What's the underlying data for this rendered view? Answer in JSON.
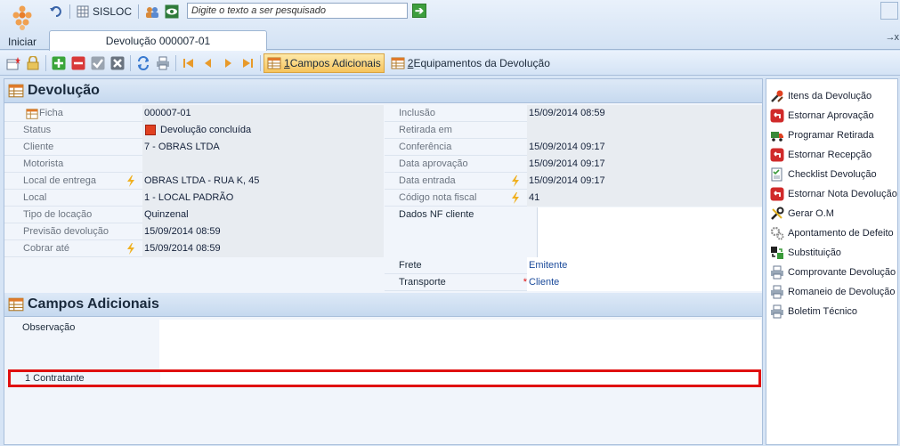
{
  "top": {
    "start_label": "Iniciar",
    "app_name": "SISLOC",
    "search_placeholder": "Digite o texto a ser pesquisado",
    "doc_tab": "Devolução 000007-01",
    "tab_arrows": "→x"
  },
  "toolbar": {
    "tab1_num": "1",
    "tab1_label": " Campos Adicionais",
    "tab2_num": "2",
    "tab2_label": " Equipamentos da Devolução"
  },
  "devolucao": {
    "title": "Devolução",
    "left_rows": [
      {
        "label": "Ficha",
        "value": "000007-01"
      },
      {
        "label": "Status",
        "value": "Devolução concluída"
      },
      {
        "label": "Cliente",
        "value": "7 - OBRAS LTDA"
      },
      {
        "label": "Motorista",
        "value": ""
      },
      {
        "label": "Local de entrega",
        "value": "OBRAS LTDA - RUA K, 45"
      },
      {
        "label": "Local",
        "value": "1 - LOCAL PADRÃO"
      },
      {
        "label": "Tipo de locação",
        "value": "Quinzenal"
      },
      {
        "label": "Previsão devolução",
        "value": "15/09/2014 08:59"
      },
      {
        "label": "Cobrar até",
        "value": "15/09/2014 08:59"
      }
    ],
    "right_rows": [
      {
        "label": "Inclusão",
        "value": "15/09/2014 08:59"
      },
      {
        "label": "Retirada em",
        "value": ""
      },
      {
        "label": "Conferência",
        "value": "15/09/2014 09:17"
      },
      {
        "label": "Data aprovação",
        "value": "15/09/2014 09:17"
      },
      {
        "label": "Data entrada",
        "value": "15/09/2014 09:17"
      },
      {
        "label": "Código nota fiscal",
        "value": "41"
      },
      {
        "label": "Dados NF cliente",
        "value": ""
      },
      {
        "label": "Frete",
        "value": "Emitente"
      },
      {
        "label": "Transporte",
        "value": "Cliente"
      }
    ]
  },
  "adicionais": {
    "title": "Campos Adicionais",
    "observacao_label": "Observação",
    "contratante_label": "1 Contratante"
  },
  "actions": [
    "Itens da Devolução",
    "Estornar Aprovação",
    "Programar Retirada",
    "Estornar Recepção",
    "Checklist Devolução",
    "Estornar Nota Devolução",
    "Gerar O.M",
    "Apontamento de Defeito",
    "Substituição",
    "Comprovante Devolução",
    "Romaneio de Devolução",
    "Boletim Técnico"
  ],
  "colors": {
    "accent_highlight": "#e01010",
    "active_tab": "#f6c35c"
  }
}
